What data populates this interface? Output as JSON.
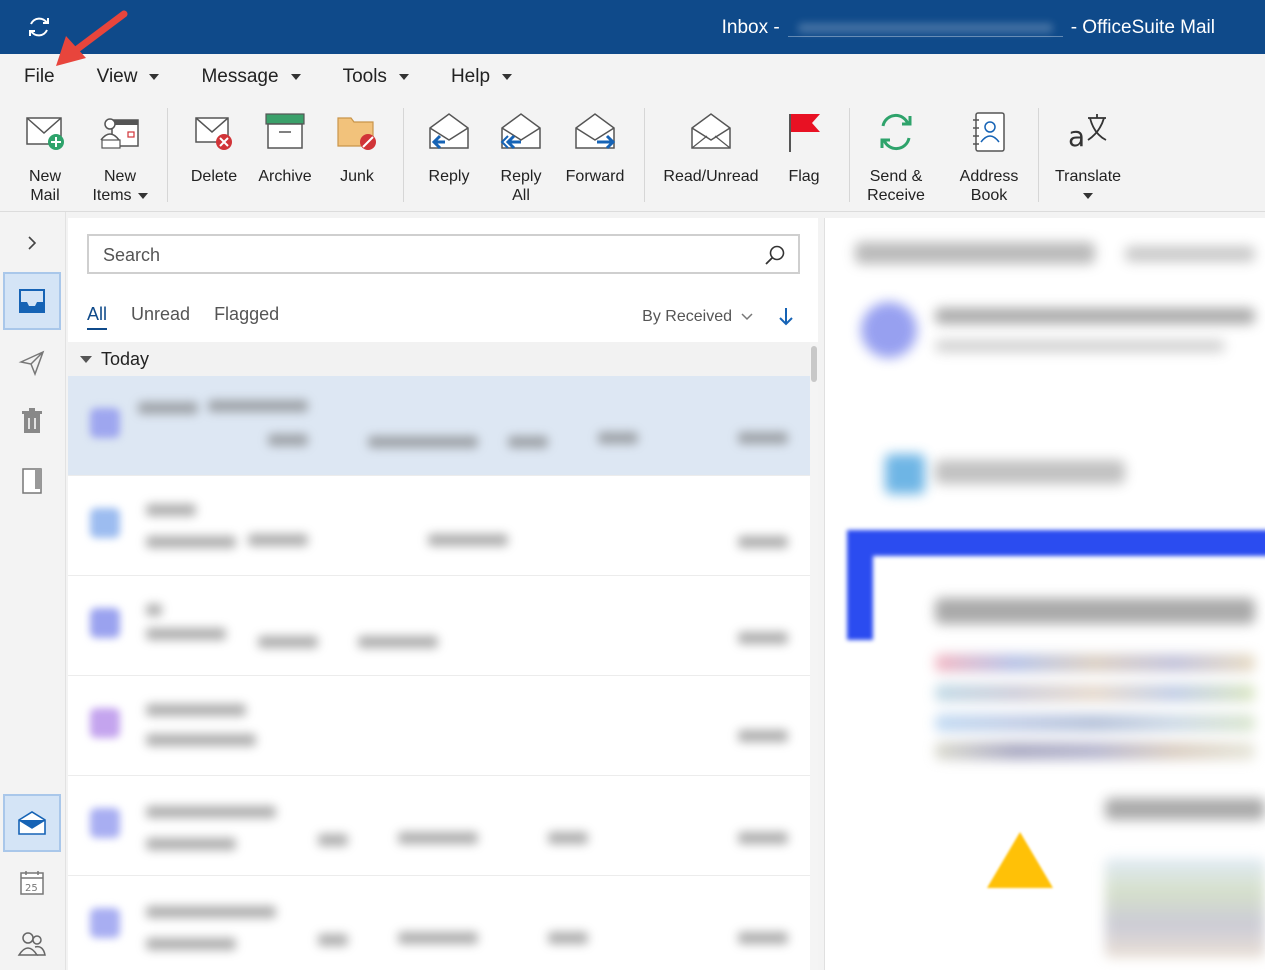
{
  "titlebar": {
    "inbox_label": "Inbox -",
    "app_suffix": "- OfficeSuite Mail"
  },
  "menu": [
    {
      "label": "File",
      "caret": false
    },
    {
      "label": "View",
      "caret": true
    },
    {
      "label": "Message",
      "caret": true
    },
    {
      "label": "Tools",
      "caret": true
    },
    {
      "label": "Help",
      "caret": true
    }
  ],
  "ribbon": {
    "new_mail": {
      "line1": "New",
      "line2": "Mail"
    },
    "new_items": {
      "line1": "New",
      "line2": "Items"
    },
    "delete": "Delete",
    "archive": "Archive",
    "junk": "Junk",
    "reply": "Reply",
    "reply_all": {
      "line1": "Reply",
      "line2": "All"
    },
    "forward": "Forward",
    "read_unread": "Read/Unread",
    "flag": "Flag",
    "send_receive": {
      "line1": "Send &",
      "line2": "Receive"
    },
    "address_book": {
      "line1": "Address",
      "line2": "Book"
    },
    "translate": "Translate"
  },
  "search": {
    "placeholder": "Search"
  },
  "filters": {
    "all": "All",
    "unread": "Unread",
    "flagged": "Flagged"
  },
  "sort": {
    "label": "By Received"
  },
  "group": {
    "label": "Today"
  },
  "colors": {
    "brand": "#0f4a8a",
    "selected_row": "#dde7f3",
    "active_nav": "#d4e4f6",
    "flag_red": "#e81123",
    "delete_red": "#d13438",
    "archive_green": "#3aa06a",
    "sync_green": "#2ea36b"
  },
  "icons": {
    "sync": "sync-icon",
    "expand": "chevron-right-icon",
    "inbox": "inbox-icon",
    "sent": "paper-plane-icon",
    "trash": "trash-icon",
    "notes": "notebook-icon",
    "mail_module": "mail-icon",
    "calendar": "calendar-icon",
    "people": "people-icon",
    "search": "search-icon"
  },
  "calendar_day": "25"
}
